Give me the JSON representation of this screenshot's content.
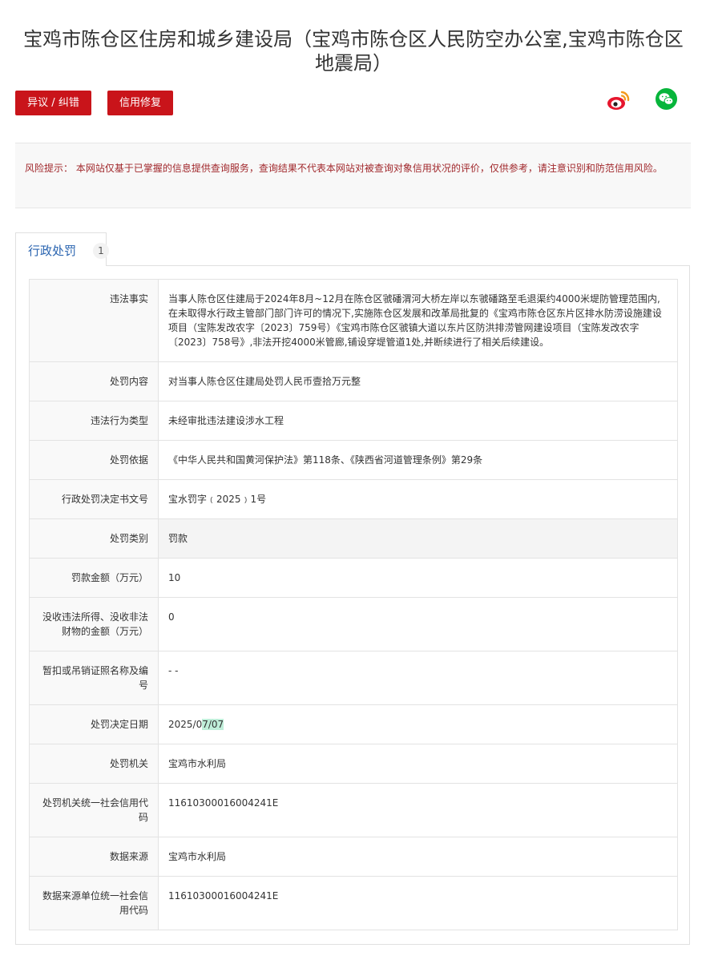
{
  "header": {
    "title": "宝鸡市陈仓区住房和城乡建设局（宝鸡市陈仓区人民防空办公室,宝鸡市陈仓区地震局）"
  },
  "actions": {
    "objection_label": "异议 / 纠错",
    "repair_label": "信用修复"
  },
  "share": {
    "weibo_icon": "weibo-icon",
    "wechat_icon": "wechat-icon",
    "weibo_color": "#e6162d",
    "wechat_color": "#07b53b"
  },
  "risk_notice": "风险提示： 本网站仅基于已掌握的信息提供查询服务，查询结果不代表本网站对被查询对象信用状况的评价，仅供参考，请注意识别和防范信用风险。",
  "tab": {
    "label": "行政处罚",
    "count": "1"
  },
  "record": {
    "rows": [
      {
        "label": "违法事实",
        "value": "当事人陈仓区住建局于2024年8月~12月在陈仓区虢磻渭河大桥左岸以东虢磻路至毛退渠约4000米堤防管理范围内,在未取得水行政主管部门部门许可的情况下,实施陈仓区发展和改革局批复的《宝鸡市陈仓区东片区排水防涝设施建设项目（宝陈发改农字〔2023〕759号）《宝鸡市陈仓区虢镇大道以东片区防洪排涝管网建设项目（宝陈发改农字〔2023〕758号》,非法开挖4000米管廊,铺设穿堤管道1处,并断续进行了相关后续建设。"
      },
      {
        "label": "处罚内容",
        "value": "对当事人陈仓区住建局处罚人民币壹拾万元整"
      },
      {
        "label": "违法行为类型",
        "value": "未经审批违法建设涉水工程"
      },
      {
        "label": "处罚依据",
        "value": "《中华人民共和国黄河保护法》第118条、《陕西省河道管理条例》第29条"
      },
      {
        "label": "行政处罚决定书文号",
        "value": "宝水罚字﹙2025﹚1号"
      },
      {
        "label": "处罚类别",
        "value": "罚款"
      },
      {
        "label": "罚款金额（万元）",
        "value": "10"
      },
      {
        "label": "没收违法所得、没收非法财物的金额（万元）",
        "value": "0"
      },
      {
        "label": "暂扣或吊销证照名称及编号",
        "value": "- -"
      },
      {
        "label": "处罚决定日期",
        "value_prefix": "2025/0",
        "value_highlight": "7/07"
      },
      {
        "label": "处罚机关",
        "value": "宝鸡市水利局"
      },
      {
        "label": "处罚机关统一社会信用代码",
        "value": "11610300016004241E"
      },
      {
        "label": "数据来源",
        "value": "宝鸡市水利局"
      },
      {
        "label": "数据来源单位统一社会信用代码",
        "value": "11610300016004241E"
      }
    ]
  }
}
